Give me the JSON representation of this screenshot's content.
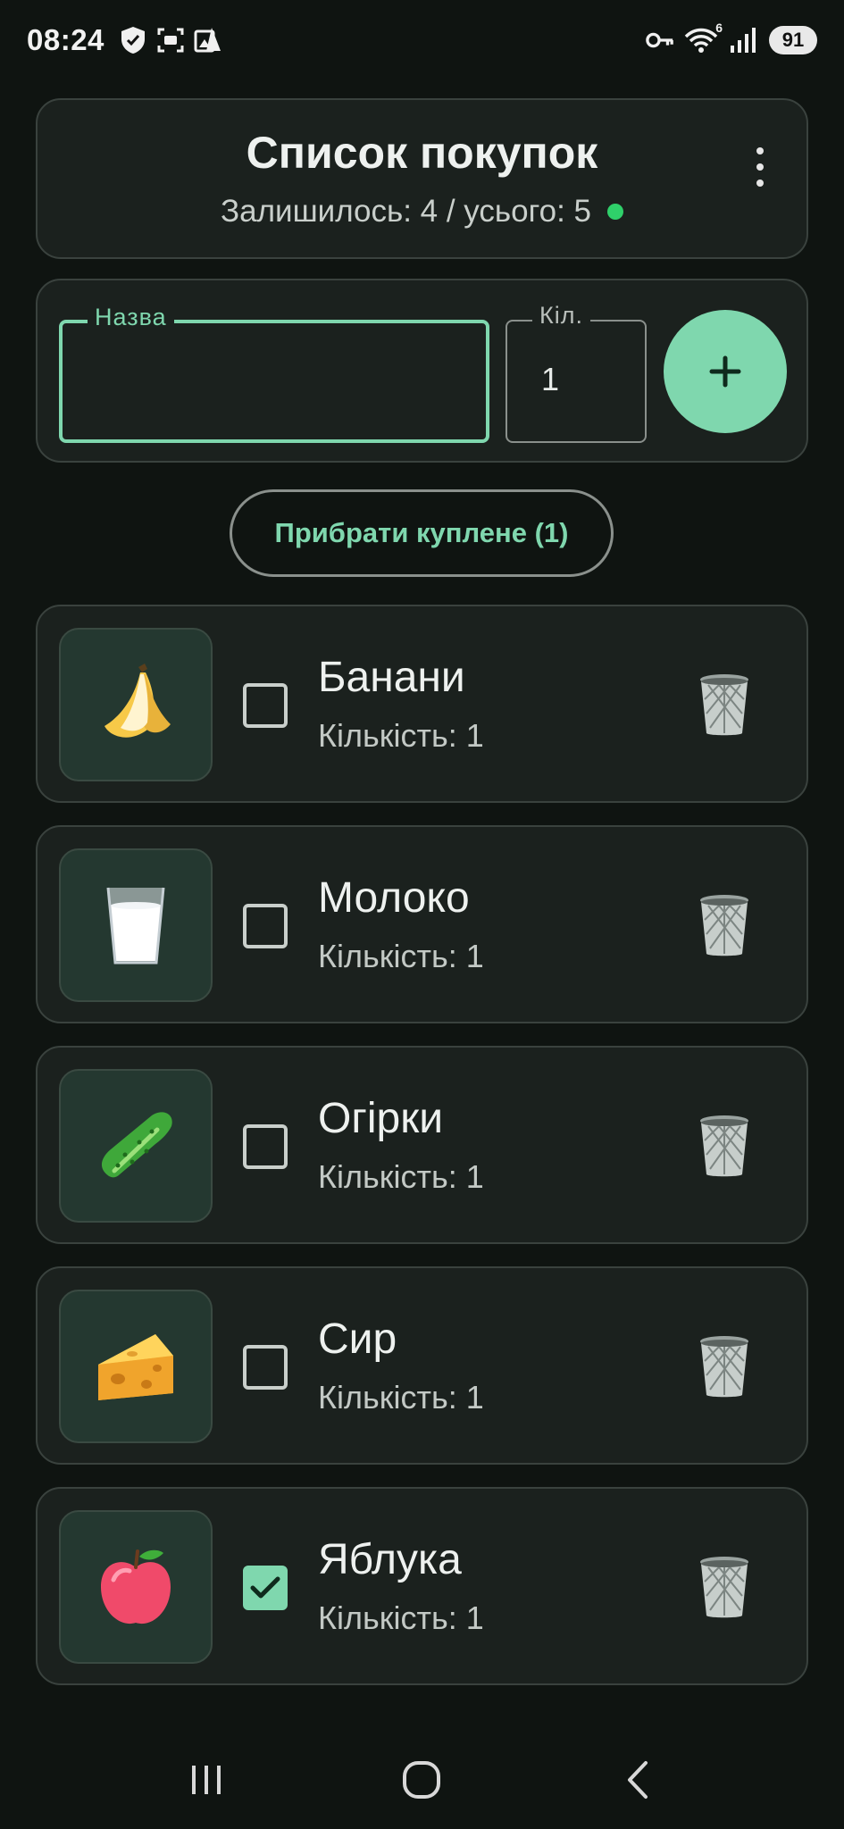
{
  "status_bar": {
    "time": "08:24",
    "battery": "91",
    "wifi_badge": "6"
  },
  "header": {
    "title": "Список покупок",
    "subtitle": "Залишилось: 4 / усього: 5"
  },
  "form": {
    "name_label": "Назва",
    "name_value": "",
    "qty_label": "Кіл.",
    "qty_value": "1"
  },
  "clear_button_label": "Прибрати куплене (1)",
  "items": [
    {
      "name": "Банани",
      "qty": "Кількість: 1",
      "icon": "banana-icon",
      "checked": false
    },
    {
      "name": "Молоко",
      "qty": "Кількість: 1",
      "icon": "milk-glass-icon",
      "checked": false
    },
    {
      "name": "Огірки",
      "qty": "Кількість: 1",
      "icon": "cucumber-icon",
      "checked": false
    },
    {
      "name": "Сир",
      "qty": "Кількість: 1",
      "icon": "cheese-icon",
      "checked": false
    },
    {
      "name": "Яблука",
      "qty": "Кількість: 1",
      "icon": "apple-icon",
      "checked": true
    }
  ],
  "colors": {
    "accent": "#7fd7ae",
    "background": "#0f1411",
    "card": "#1b211e",
    "status_dot": "#2fd06a"
  }
}
